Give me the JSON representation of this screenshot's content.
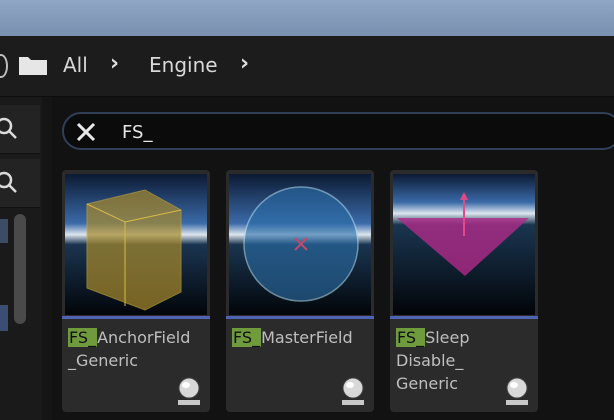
{
  "breadcrumb": {
    "items": [
      {
        "label": "All"
      },
      {
        "label": "Engine"
      }
    ]
  },
  "search": {
    "value": "FS_"
  },
  "assets": [
    {
      "prefix": "FS_",
      "line1": "AnchorField",
      "line2": "_Generic",
      "line3": ""
    },
    {
      "prefix": "FS_",
      "line1": "MasterField",
      "line2": "",
      "line3": ""
    },
    {
      "prefix": "FS_",
      "line1": "Sleep",
      "line2": "Disable_",
      "line3": "Generic"
    }
  ],
  "colors": {
    "highlight": "#6f9b3c",
    "accent_bar": "#4f63b5",
    "search_border": "#2f3f58"
  },
  "icons": [
    "folder-icon",
    "chevron-right-icon",
    "search-icon",
    "clear-icon",
    "preview-sphere-icon"
  ]
}
